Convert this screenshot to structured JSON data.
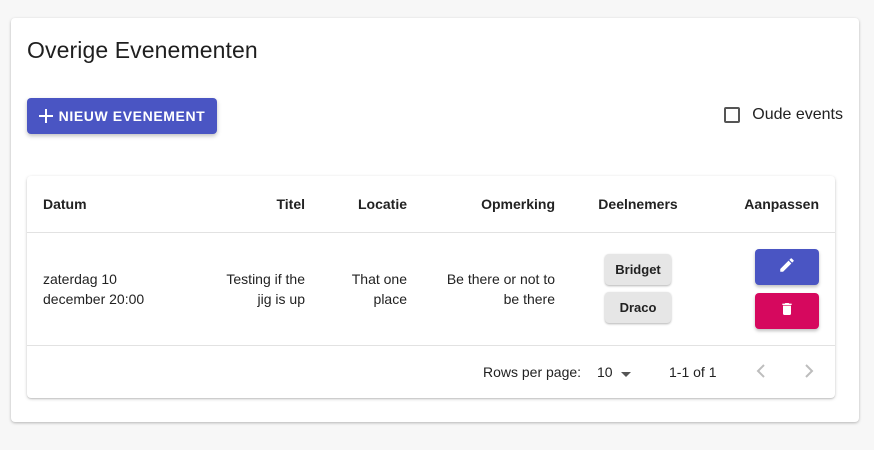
{
  "page": {
    "title": "Overige Evenementen",
    "new_button_label": "NIEUW EVENEMENT",
    "old_events_label": "Oude events"
  },
  "colors": {
    "primary": "#4a55c3",
    "danger": "#d6085e"
  },
  "table": {
    "headers": {
      "datum": "Datum",
      "titel": "Titel",
      "locatie": "Locatie",
      "opmerking": "Opmerking",
      "deelnemers": "Deelnemers",
      "aanpassen": "Aanpassen"
    },
    "rows": [
      {
        "datum_line1": "zaterdag 10",
        "datum_line2": "december 20:00",
        "titel_line1": "Testing if the",
        "titel_line2": "jig is up",
        "locatie_line1": "That one",
        "locatie_line2": "place",
        "opmerking_line1": "Be there or not to",
        "opmerking_line2": "be there",
        "deelnemers": [
          "Bridget",
          "Draco"
        ]
      }
    ],
    "footer": {
      "rows_per_page_label": "Rows per page:",
      "rows_per_page_value": "10",
      "range": "1-1 of 1"
    }
  }
}
